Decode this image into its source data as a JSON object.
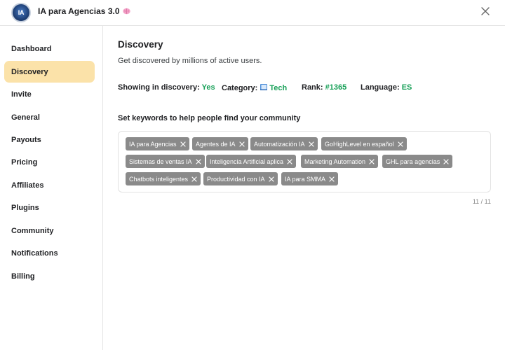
{
  "header": {
    "logo_text": "IA",
    "title": "IA para Agencias 3.0",
    "brain_icon": "brain-icon",
    "close_icon": "close-icon"
  },
  "sidebar": {
    "items": [
      {
        "label": "Dashboard",
        "active": false
      },
      {
        "label": "Discovery",
        "active": true
      },
      {
        "label": "Invite",
        "active": false
      },
      {
        "label": "General",
        "active": false
      },
      {
        "label": "Payouts",
        "active": false
      },
      {
        "label": "Pricing",
        "active": false
      },
      {
        "label": "Affiliates",
        "active": false
      },
      {
        "label": "Plugins",
        "active": false
      },
      {
        "label": "Community",
        "active": false
      },
      {
        "label": "Notifications",
        "active": false
      },
      {
        "label": "Billing",
        "active": false
      }
    ]
  },
  "discovery": {
    "title": "Discovery",
    "description": "Get discovered by millions of active users.",
    "stats": {
      "showing_label": "Showing in discovery:",
      "showing_value": "Yes",
      "category_label": "Category:",
      "category_icon": "book-icon",
      "category_value": "Tech",
      "rank_label": "Rank:",
      "rank_value": "#1365",
      "language_label": "Language:",
      "language_value": "ES"
    },
    "keywords_title": "Set keywords to help people find your community",
    "keywords": [
      "IA para Agencias",
      "Agentes de IA",
      "Automatización IA",
      "GoHighLevel en español",
      "Sistemas de ventas IA",
      "Inteligencia Artificial aplica",
      "Marketing Automation",
      "GHL para agencias",
      "Chatbots inteligentes",
      "Productividad con IA",
      "IA para SMMA"
    ],
    "counter": "11 / 11"
  },
  "colors": {
    "accent_active_bg": "#fbe2a9",
    "stat_value_green": "#18a058",
    "tag_bg": "#8a8a8a"
  }
}
